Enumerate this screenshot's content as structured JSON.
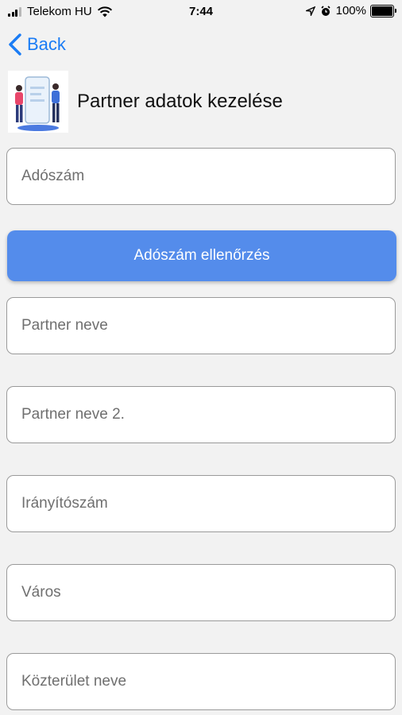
{
  "status_bar": {
    "carrier": "Telekom HU",
    "time": "7:44",
    "battery": "100%"
  },
  "nav": {
    "back_label": "Back"
  },
  "header": {
    "title": "Partner adatok kezelése"
  },
  "form": {
    "tax_number_placeholder": "Adószám",
    "check_button_label": "Adószám ellenőrzés",
    "partner_name_placeholder": "Partner neve",
    "partner_name2_placeholder": "Partner neve 2.",
    "zip_placeholder": "Irányítószám",
    "city_placeholder": "Város",
    "street_placeholder": "Közterület neve"
  },
  "colors": {
    "accent": "#1a7cf5",
    "button": "#548ceb",
    "background": "#f2f2f2"
  }
}
